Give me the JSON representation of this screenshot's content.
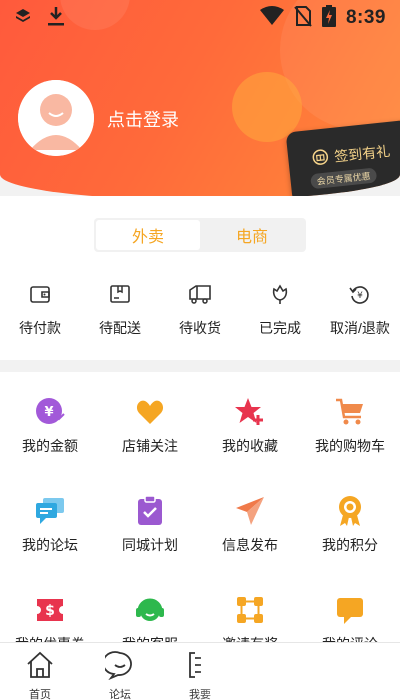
{
  "status_bar": {
    "time": "8:39",
    "left_icons": [
      "layers-icon",
      "download-icon"
    ],
    "right_icons": [
      "wifi-icon",
      "no-sim-icon",
      "battery-charging-icon"
    ]
  },
  "header": {
    "login_text": "点击登录",
    "signin_card": {
      "title": "签到有礼",
      "subtitle": "会员专属优惠"
    },
    "colors": {
      "gradient_start": "#ff5a3c",
      "gradient_end": "#ff8a3a"
    }
  },
  "tabs": [
    {
      "label": "外卖",
      "active": true
    },
    {
      "label": "电商",
      "active": false
    }
  ],
  "orders": [
    {
      "label": "待付款",
      "icon": "wallet-icon"
    },
    {
      "label": "待配送",
      "icon": "package-icon"
    },
    {
      "label": "待收货",
      "icon": "truck-icon"
    },
    {
      "label": "已完成",
      "icon": "flower-icon"
    },
    {
      "label": "取消/退款",
      "icon": "refund-icon"
    }
  ],
  "grid": [
    {
      "label": "我的金额",
      "icon": "yen-coin-icon",
      "color": "#a259d9"
    },
    {
      "label": "店铺关注",
      "icon": "heart-icon",
      "color": "#f5a623"
    },
    {
      "label": "我的收藏",
      "icon": "star-plus-icon",
      "color": "#e8344e"
    },
    {
      "label": "我的购物车",
      "icon": "cart-icon",
      "color": "#f08a4b"
    },
    {
      "label": "我的论坛",
      "icon": "chat-bubbles-icon",
      "color": "#2fa8e0"
    },
    {
      "label": "同城计划",
      "icon": "clipboard-check-icon",
      "color": "#9b59d0"
    },
    {
      "label": "信息发布",
      "icon": "paper-plane-icon",
      "color": "#f07a4a"
    },
    {
      "label": "我的积分",
      "icon": "medal-icon",
      "color": "#f5a623"
    },
    {
      "label": "我的优惠券",
      "icon": "coupon-icon",
      "color": "#e8344e"
    },
    {
      "label": "我的客服",
      "icon": "headset-icon",
      "color": "#2db84d"
    },
    {
      "label": "邀请有奖",
      "icon": "network-icon",
      "color": "#f5a623"
    },
    {
      "label": "我的评论",
      "icon": "comment-icon",
      "color": "#f5a623"
    }
  ],
  "bottom_nav": [
    {
      "label": "首页",
      "icon": "home-icon"
    },
    {
      "label": "论坛",
      "icon": "smile-chat-icon"
    },
    {
      "label": "我要",
      "icon": "publish-icon"
    }
  ]
}
